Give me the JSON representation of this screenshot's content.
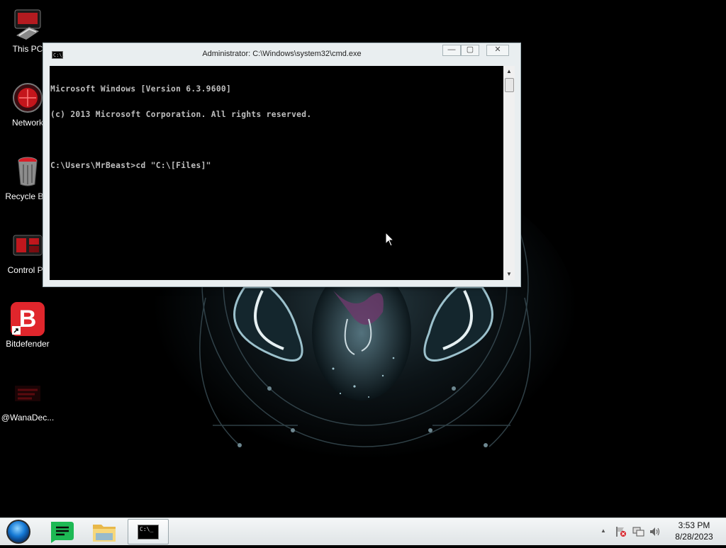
{
  "desktop": {
    "icons": [
      {
        "label": "This PC"
      },
      {
        "label": "Network"
      },
      {
        "label": "Recycle Bin"
      },
      {
        "label": "Control Pa"
      },
      {
        "label": "Bitdefender",
        "glyph": "B"
      },
      {
        "label": "@WanaDec..."
      }
    ]
  },
  "cmd": {
    "title": "Administrator: C:\\Windows\\system32\\cmd.exe",
    "sysicon_text": "C:\\.",
    "lines": [
      "Microsoft Windows [Version 6.3.9600]",
      "(c) 2013 Microsoft Corporation. All rights reserved.",
      "",
      "C:\\Users\\MrBeast>cd \"C:\\[Files]\""
    ],
    "minimize_glyph": "—",
    "maximize_glyph": "▢",
    "close_glyph": "✕"
  },
  "taskbar": {
    "start_icon": "start-orb-icon",
    "pinned": [
      "notes-app-icon",
      "file-explorer-icon",
      "command-prompt-icon"
    ],
    "cmd_glyph": "C:\\_",
    "tray_icons": [
      "show-hidden-icons-chevron",
      "action-center-flag-icon",
      "network-icon",
      "volume-icon"
    ],
    "tray_chevron": "▲",
    "time": "3:53 PM",
    "date": "8/28/2023"
  },
  "colors": {
    "bitdefender_red": "#e0262c",
    "console_text": "#c0c0c0",
    "notes_green": "#1db954"
  }
}
